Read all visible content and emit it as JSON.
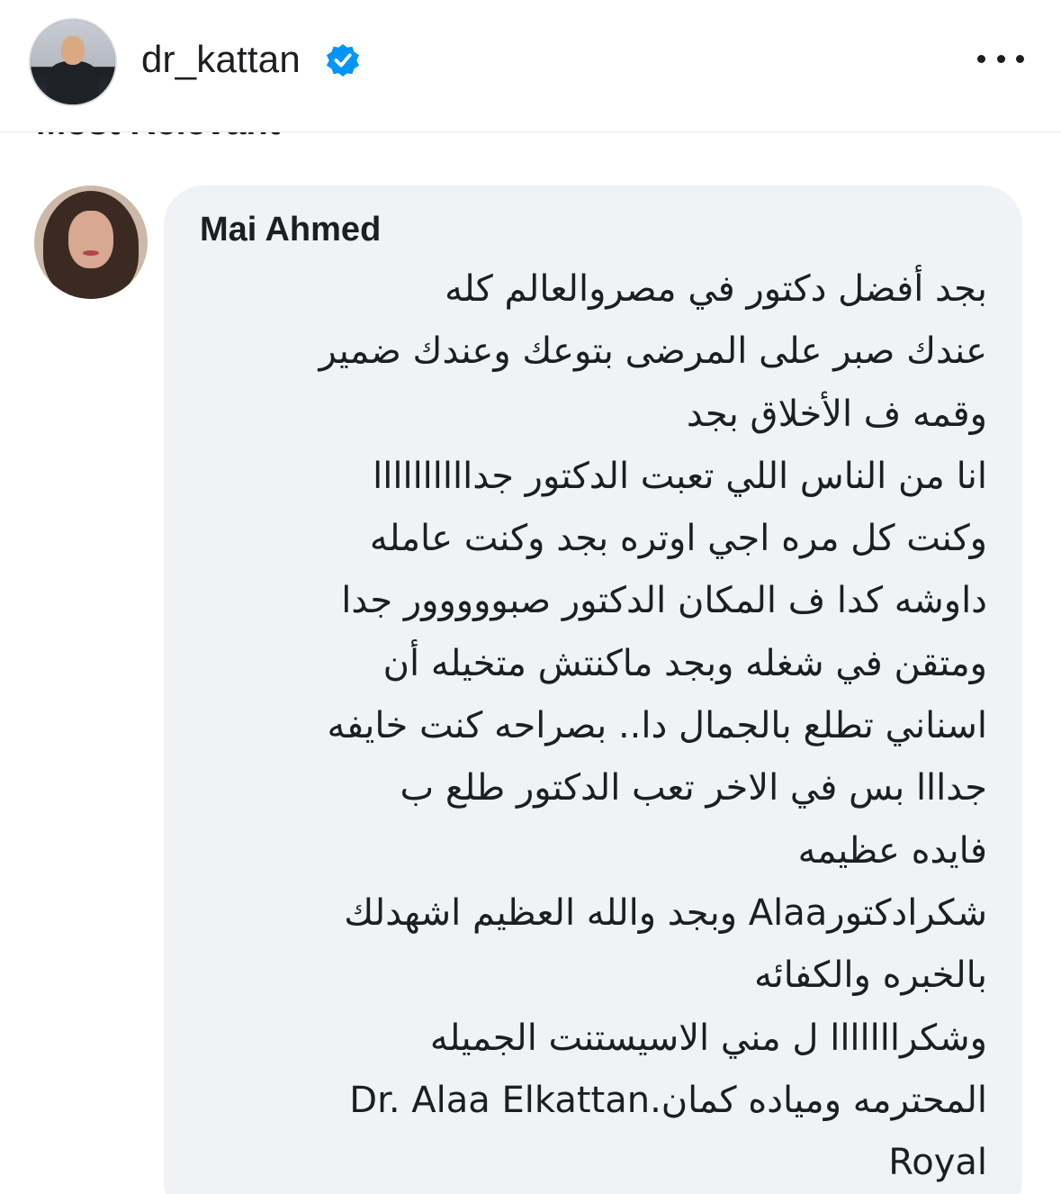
{
  "header": {
    "username": "dr_kattan",
    "verified_icon": "verified-badge-icon",
    "more_icon": "more-options-icon"
  },
  "section_heading": "Most Relevant",
  "comment": {
    "author": "Mai Ahmed",
    "lines": [
      "بجد أفضل دكتور في مصروالعالم كله",
      "عندك صبر على المرضى بتوعك وعندك ضمير",
      "وقمه ف الأخلاق بجد",
      "انا من الناس اللي تعبت الدكتور جداااااااااا",
      "وكنت كل مره اجي اوتره بجد وكنت عامله",
      "داوشه كدا ف المكان الدكتور  صبووووور جدا",
      "ومتقن في شغله وبجد ماكنتش متخيله أن",
      "اسناني تطلع بالجمال دا.. بصراحه كنت خايفه",
      "جدااا بس في الاخر تعب الدكتور طلع ب",
      "فايده عظيمه",
      "شكرادكتورAlaa وبجد والله العظيم اشهدلك",
      "بالخبره والكفائه",
      "وشكرااااااا ل مني الاسيستنت الجميله",
      "المحترمه ومياده كمان.Dr. Alaa Elkattan",
      "Royal"
    ]
  },
  "colors": {
    "bubble": "#f0f2f5",
    "verified": "#0095f6",
    "text": "#1c1e21"
  }
}
